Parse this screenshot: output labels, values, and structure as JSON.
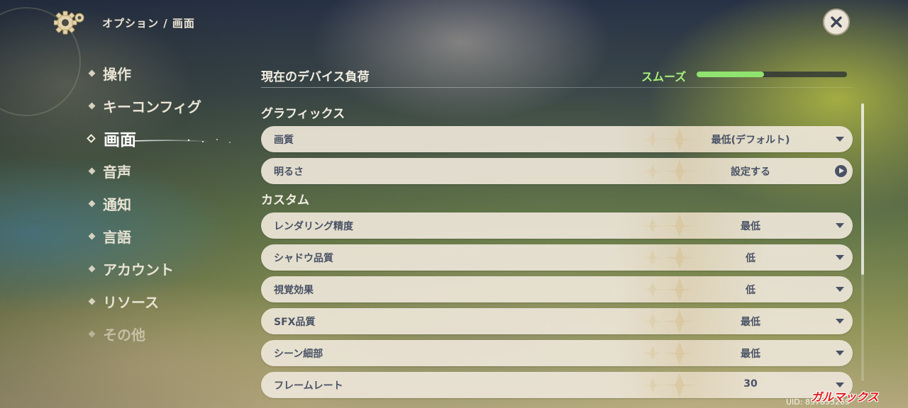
{
  "header": {
    "breadcrumb": "オプション / 画面",
    "settings_icon": "gear-icon",
    "close_icon": "close-icon"
  },
  "nav": {
    "items": [
      {
        "label": "操作"
      },
      {
        "label": "キーコンフィグ"
      },
      {
        "label": "画面",
        "active": true
      },
      {
        "label": "音声"
      },
      {
        "label": "通知"
      },
      {
        "label": "言語"
      },
      {
        "label": "アカウント"
      },
      {
        "label": "リソース"
      },
      {
        "label": "その他"
      }
    ]
  },
  "load": {
    "label": "現在のデバイス負荷",
    "status": "スムーズ",
    "level": 0.45,
    "status_color": "#a9f07b"
  },
  "sections": {
    "graphics_title": "グラフィックス",
    "custom_title": "カスタム"
  },
  "graphics": {
    "quality": {
      "label": "画質",
      "value": "最低(デフォルト)"
    },
    "brightness": {
      "label": "明るさ",
      "value": "設定する"
    }
  },
  "custom": {
    "rows": [
      {
        "label": "レンダリング精度",
        "value": "最低"
      },
      {
        "label": "シャドウ品質",
        "value": "低"
      },
      {
        "label": "視覚効果",
        "value": "低"
      },
      {
        "label": "SFX品質",
        "value": "最低"
      },
      {
        "label": "シーン細部",
        "value": "最低"
      },
      {
        "label": "フレームレート",
        "value": "30"
      }
    ]
  },
  "footer": {
    "uid": "UID: 857853269",
    "watermark": "ガルマックス"
  }
}
